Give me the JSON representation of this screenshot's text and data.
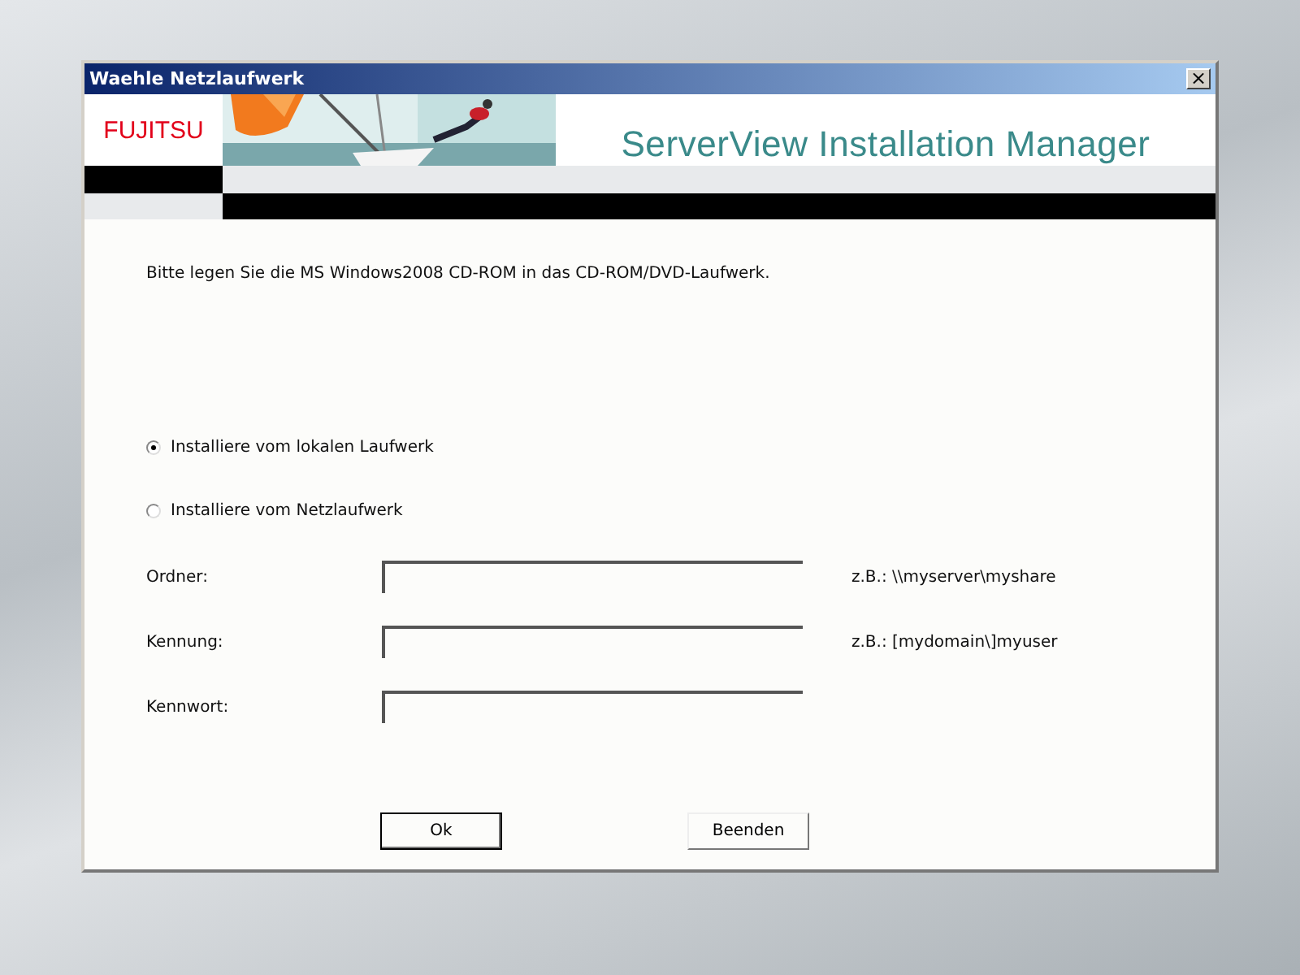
{
  "window": {
    "title": "Waehle Netzlaufwerk",
    "close": "×"
  },
  "banner": {
    "logo": "FUJITSU",
    "title": "ServerView Installation Manager"
  },
  "instruction": "Bitte legen Sie die MS Windows2008 CD-ROM in das CD-ROM/DVD-Laufwerk.",
  "options": [
    {
      "label": "Installiere vom lokalen Laufwerk",
      "selected": true
    },
    {
      "label": "Installiere vom Netzlaufwerk",
      "selected": false
    }
  ],
  "fields": [
    {
      "label": "Ordner:",
      "hint": "z.B.: \\\\myserver\\myshare"
    },
    {
      "label": "Kennung:",
      "hint": "z.B.: [mydomain\\]myuser"
    },
    {
      "label": "Kennwort:"
    }
  ],
  "buttons": [
    {
      "label": "Ok",
      "default": true
    },
    {
      "label": "Beenden",
      "default": false
    }
  ]
}
